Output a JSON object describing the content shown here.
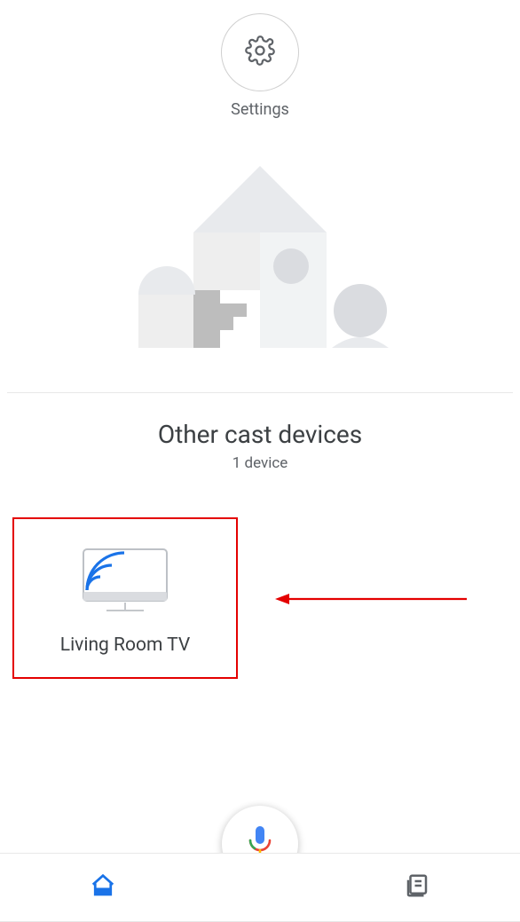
{
  "header": {
    "settings_label": "Settings"
  },
  "section": {
    "title": "Other cast devices",
    "device_count": "1 device"
  },
  "devices": [
    {
      "name": "Living Room TV",
      "icon": "chromecast-tv-icon"
    }
  ],
  "annotations": {
    "highlight_color": "#e40000",
    "arrow_target": "device-card"
  },
  "colors": {
    "accent": "#1a73e8",
    "muted_text": "#5f6368",
    "text": "#3c4043",
    "divider": "#e8e8e8"
  },
  "nav": {
    "home_active": true
  }
}
